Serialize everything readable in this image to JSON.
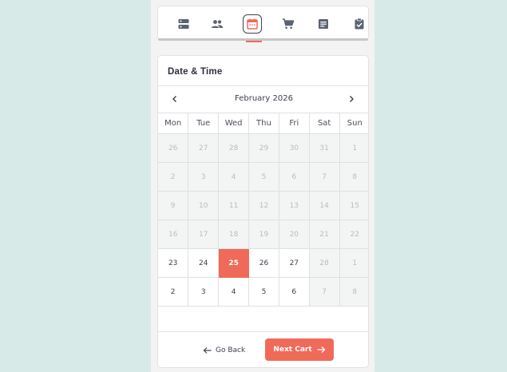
{
  "steps": [
    {
      "name": "services",
      "icon": "server-icon"
    },
    {
      "name": "staff",
      "icon": "people-icon"
    },
    {
      "name": "date-time",
      "icon": "calendar-icon"
    },
    {
      "name": "cart",
      "icon": "cart-icon"
    },
    {
      "name": "information",
      "icon": "form-icon"
    },
    {
      "name": "confirmation",
      "icon": "clipboard-check-icon"
    }
  ],
  "colors": {
    "accent": "#f06a5a",
    "background": "#d8eae8",
    "text": "#3c4150"
  },
  "panel": {
    "title": "Date & Time"
  },
  "calendar": {
    "month_label": "February 2026",
    "weekdays": [
      "Mon",
      "Tue",
      "Wed",
      "Thu",
      "Fri",
      "Sat",
      "Sun"
    ],
    "selected": "25",
    "weeks": [
      [
        {
          "d": "26",
          "s": "dis"
        },
        {
          "d": "27",
          "s": "dis"
        },
        {
          "d": "28",
          "s": "dis"
        },
        {
          "d": "29",
          "s": "dis"
        },
        {
          "d": "30",
          "s": "dis"
        },
        {
          "d": "31",
          "s": "dis"
        },
        {
          "d": "1",
          "s": "dis"
        }
      ],
      [
        {
          "d": "2",
          "s": "dis"
        },
        {
          "d": "3",
          "s": "dis"
        },
        {
          "d": "4",
          "s": "dis"
        },
        {
          "d": "5",
          "s": "dis"
        },
        {
          "d": "6",
          "s": "dis"
        },
        {
          "d": "7",
          "s": "dis"
        },
        {
          "d": "8",
          "s": "dis"
        }
      ],
      [
        {
          "d": "9",
          "s": "dis"
        },
        {
          "d": "10",
          "s": "dis"
        },
        {
          "d": "11",
          "s": "dis"
        },
        {
          "d": "12",
          "s": "dis"
        },
        {
          "d": "13",
          "s": "dis"
        },
        {
          "d": "14",
          "s": "dis"
        },
        {
          "d": "15",
          "s": "dis"
        }
      ],
      [
        {
          "d": "16",
          "s": "dis"
        },
        {
          "d": "17",
          "s": "dis"
        },
        {
          "d": "18",
          "s": "dis"
        },
        {
          "d": "19",
          "s": "dis"
        },
        {
          "d": "20",
          "s": "dis"
        },
        {
          "d": "21",
          "s": "dis"
        },
        {
          "d": "22",
          "s": "dis"
        }
      ],
      [
        {
          "d": "23",
          "s": "avail"
        },
        {
          "d": "24",
          "s": "avail"
        },
        {
          "d": "25",
          "s": "sel"
        },
        {
          "d": "26",
          "s": "avail"
        },
        {
          "d": "27",
          "s": "avail"
        },
        {
          "d": "28",
          "s": "dis"
        },
        {
          "d": "1",
          "s": "dis"
        }
      ],
      [
        {
          "d": "2",
          "s": "avail"
        },
        {
          "d": "3",
          "s": "avail"
        },
        {
          "d": "4",
          "s": "avail"
        },
        {
          "d": "5",
          "s": "avail"
        },
        {
          "d": "6",
          "s": "avail"
        },
        {
          "d": "7",
          "s": "dis"
        },
        {
          "d": "8",
          "s": "dis"
        }
      ]
    ]
  },
  "footer": {
    "back_label": "Go Back",
    "next_label": "Next Cart"
  }
}
